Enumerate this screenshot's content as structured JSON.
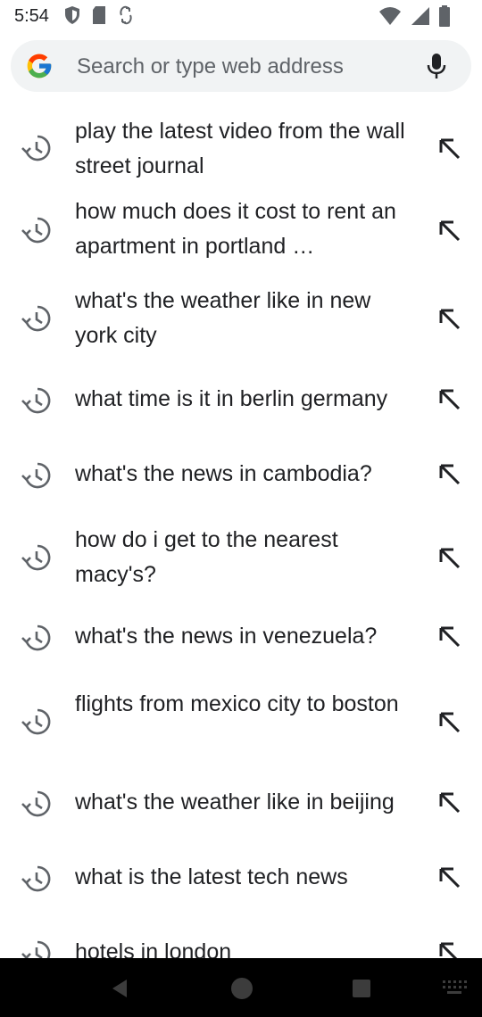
{
  "status": {
    "time": "5:54",
    "left_icons": [
      "shield-icon",
      "sd-card-icon",
      "sync-icon"
    ],
    "right_icons": [
      "wifi-icon",
      "cellular-icon",
      "battery-icon"
    ]
  },
  "search": {
    "placeholder": "Search or type web address",
    "value": "",
    "logo": "google-g-icon",
    "mic": "microphone-icon"
  },
  "suggestions": [
    {
      "text": "play the latest video from the wall street journal"
    },
    {
      "text": "how much does it cost to rent an apartment in portland …"
    },
    {
      "text": "what's the weather like in new york city"
    },
    {
      "text": "what time is it in berlin germany"
    },
    {
      "text": "what's the news in cambodia?"
    },
    {
      "text": "how do i get to the nearest macy's?"
    },
    {
      "text": "what's the news in venezuela?"
    },
    {
      "text": "flights from mexico city to boston"
    },
    {
      "text": "what's the weather like in beijing"
    },
    {
      "text": "what is the latest tech news"
    },
    {
      "text": "hotels in london"
    }
  ],
  "nav": {
    "back": "back-icon",
    "home": "home-icon",
    "recents": "recents-icon",
    "keyboard": "keyboard-icon"
  },
  "colors": {
    "search_bg": "#f1f3f4",
    "icon_gray": "#5f6368",
    "text": "#202124",
    "nav_bg": "#000000"
  }
}
